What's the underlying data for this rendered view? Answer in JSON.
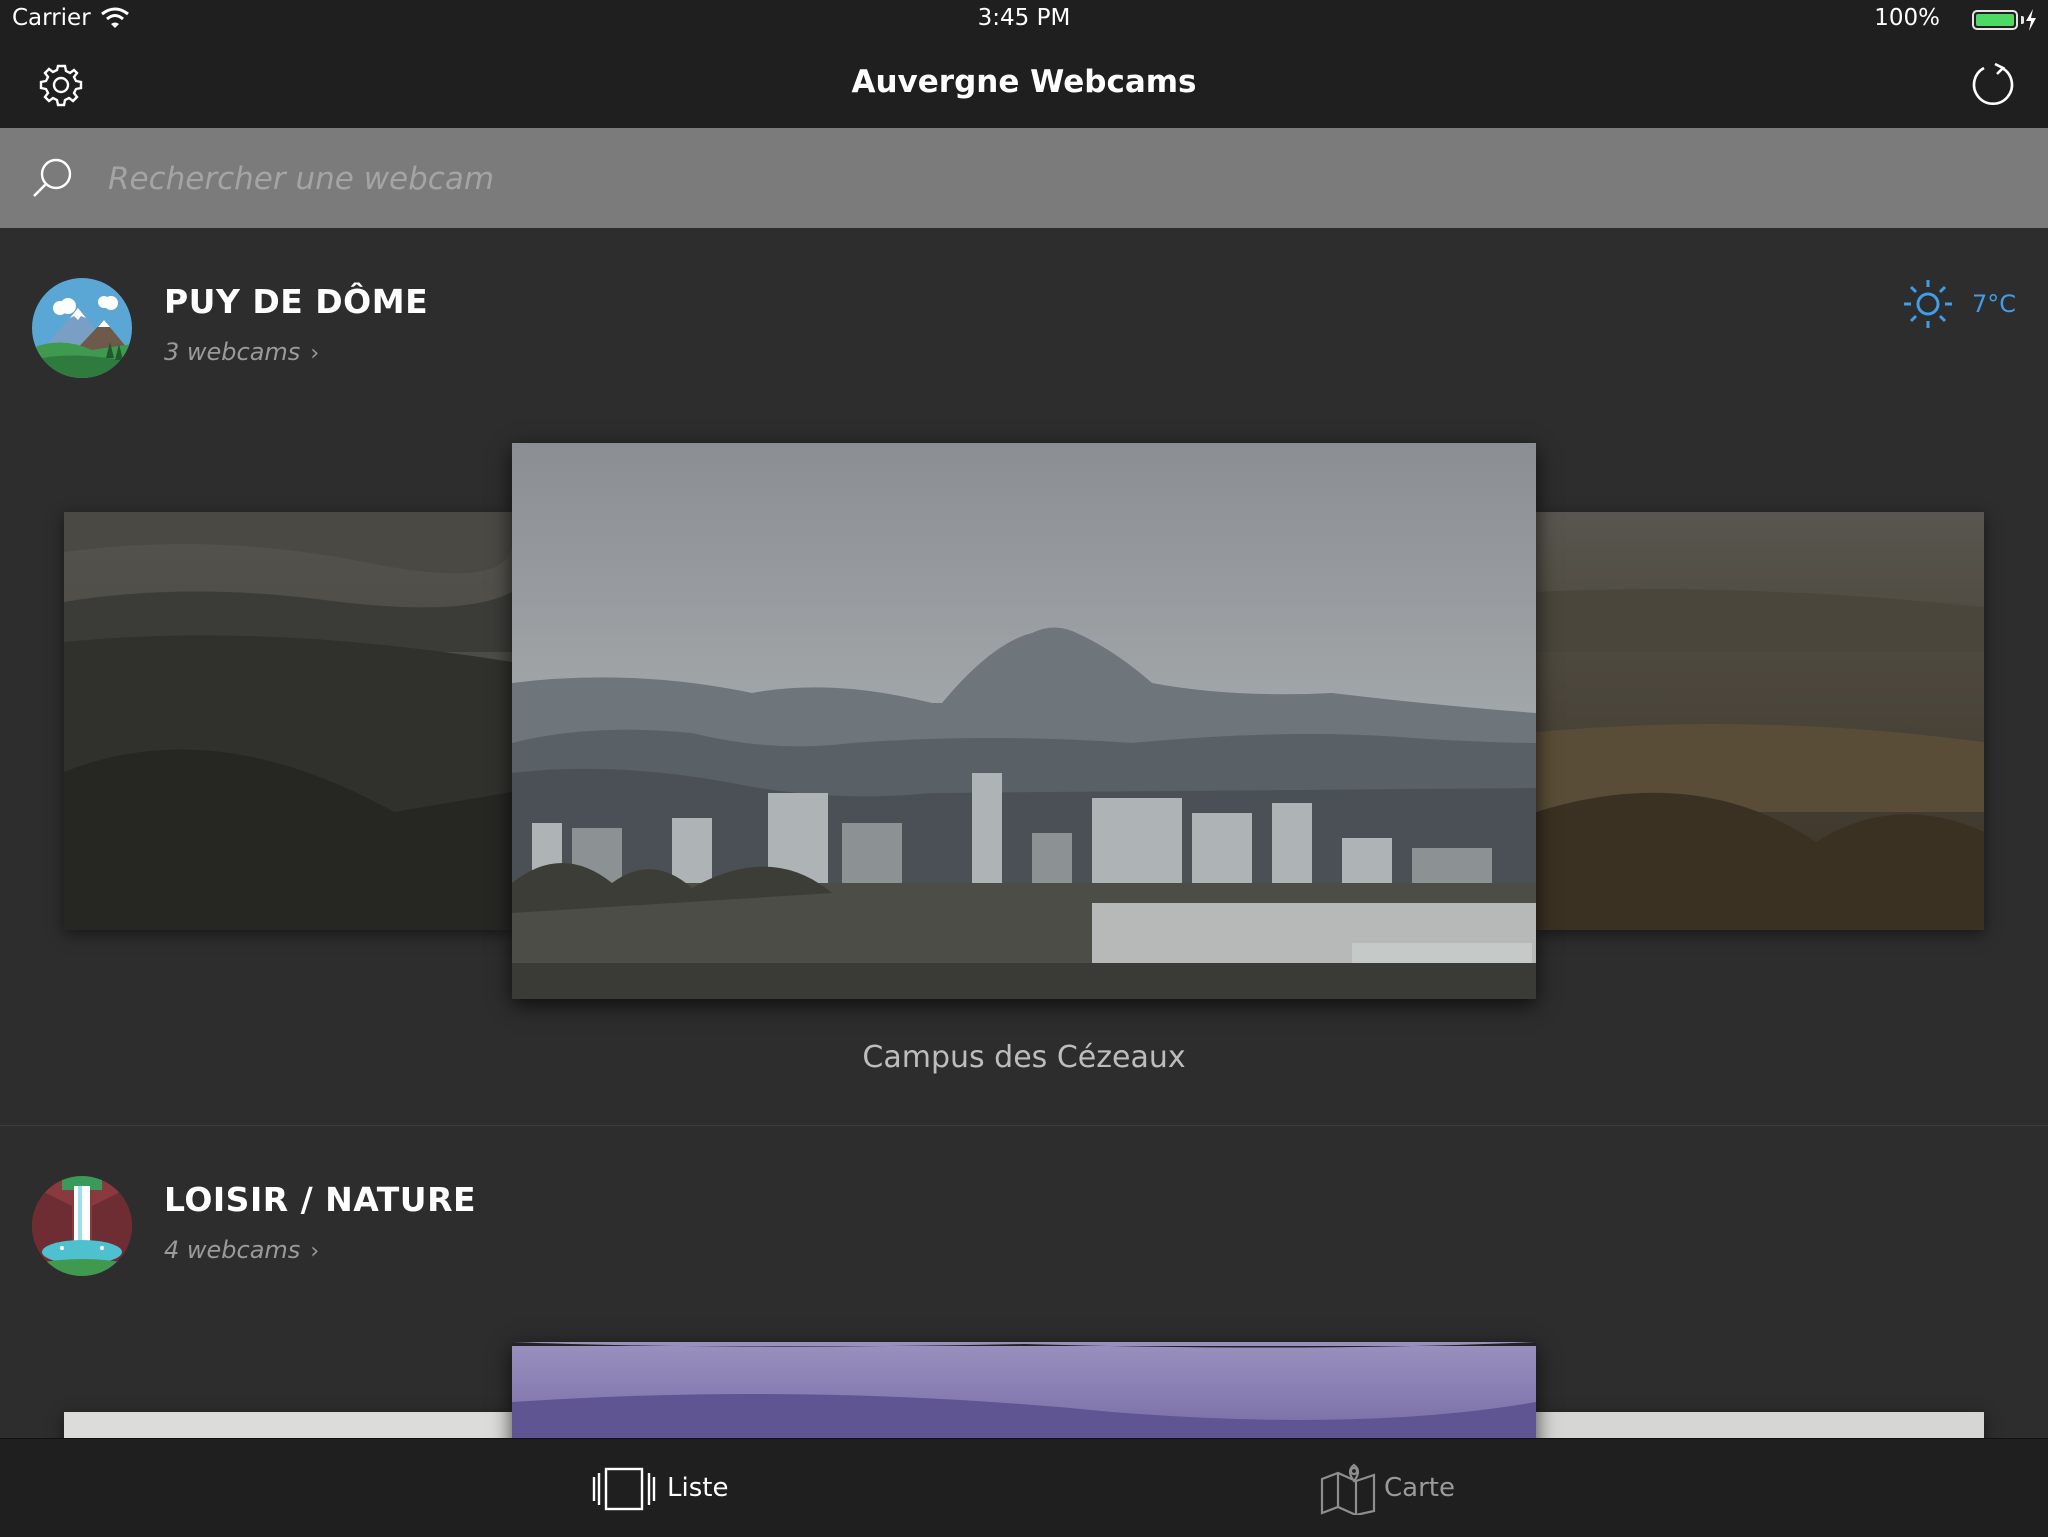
{
  "status_bar": {
    "carrier": "Carrier",
    "time": "3:45 PM",
    "battery": "100%"
  },
  "nav": {
    "title": "Auvergne Webcams",
    "left_icon": "gear-icon",
    "right_icon": "refresh-icon"
  },
  "search": {
    "placeholder": "Rechercher une webcam"
  },
  "sections": [
    {
      "title": "PUY DE DÔME",
      "count": "3 webcams",
      "weather": {
        "icon": "sun-icon",
        "temperature": "7°C",
        "color": "#3e9ee8"
      },
      "featured_caption": "Campus des Cézeaux"
    },
    {
      "title": "LOISIR / NATURE",
      "count": "4 webcams"
    }
  ],
  "tabs": [
    {
      "label": "Liste",
      "icon": "carousel-icon",
      "selected": true
    },
    {
      "label": "Carte",
      "icon": "map-icon",
      "selected": false
    }
  ],
  "colors": {
    "accent": "#3e9ee8",
    "background": "#2d2d2e",
    "bars": "#1f1f1f",
    "search_bar": "#7b7b7b"
  }
}
